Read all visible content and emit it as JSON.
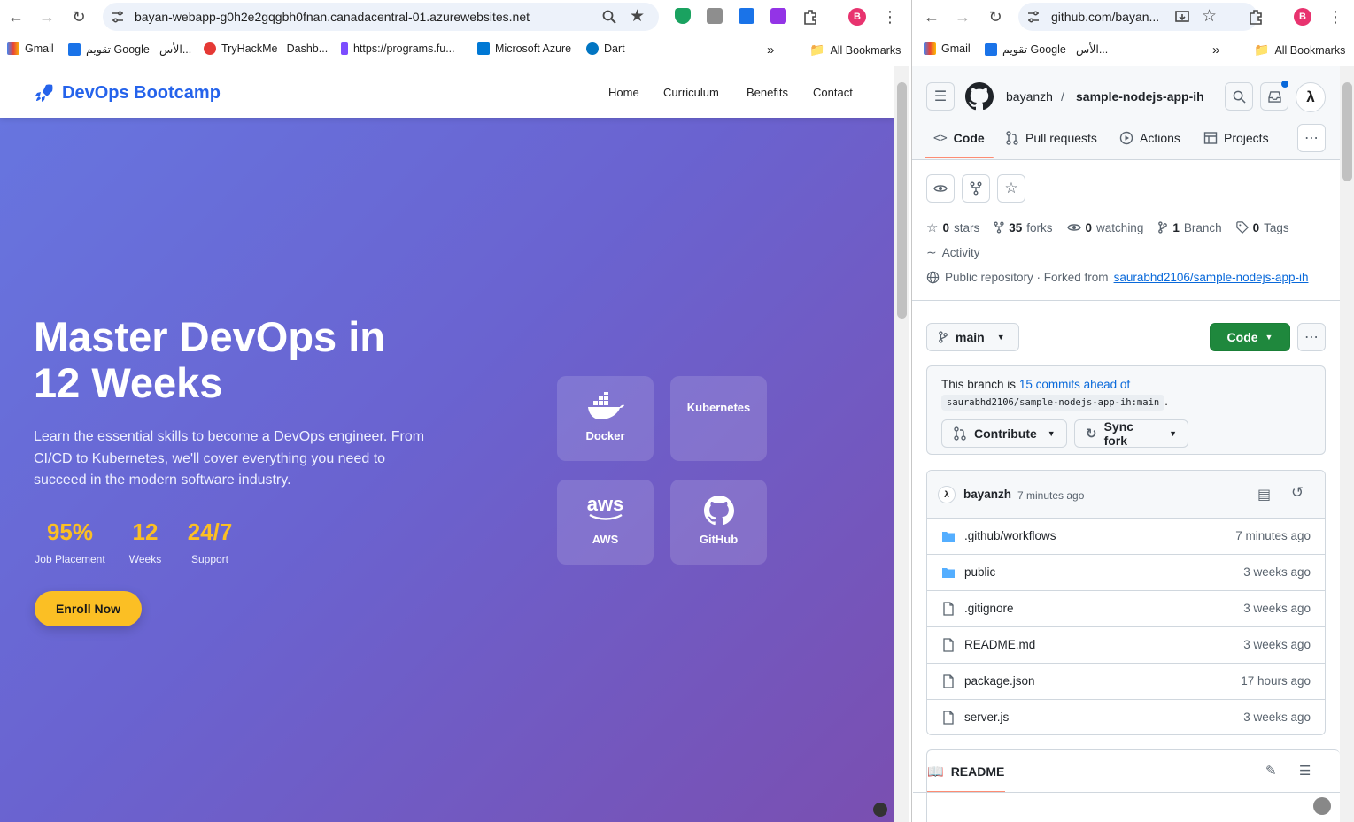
{
  "left_browser": {
    "url": "bayan-webapp-g0h2e2gqgbh0fnan.canadacentral-01.azurewebsites.net",
    "profile_initial": "B",
    "bookmarks": [
      "Gmail",
      "تقويم Google - الأس...",
      "TryHackMe | Dashb...",
      "https://programs.fu...",
      "Microsoft Azure",
      "Dart"
    ],
    "more_bookmarks": "»",
    "all_bookmarks": "All Bookmarks"
  },
  "devops_page": {
    "brand": "DevOps Bootcamp",
    "nav": [
      "Home",
      "Curriculum",
      "Benefits",
      "Contact"
    ],
    "hero_title": "Master DevOps in 12 Weeks",
    "hero_subtitle": "Learn the essential skills to become a DevOps engineer. From CI/CD to Kubernetes, we'll cover everything you need to succeed in the modern software industry.",
    "stats": [
      {
        "value": "95%",
        "label": "Job Placement"
      },
      {
        "value": "12",
        "label": "Weeks"
      },
      {
        "value": "24/7",
        "label": "Support"
      }
    ],
    "cta": "Enroll Now",
    "tech_cards": [
      "Docker",
      "Kubernetes",
      "AWS",
      "GitHub"
    ],
    "aws_logo_text": "aws",
    "colors": {
      "brand": "#2563eb",
      "accent": "#fbbf24",
      "hero_start": "#6775df",
      "hero_end": "#7a4fb1"
    }
  },
  "right_browser": {
    "url": "github.com/bayan...",
    "profile_initial": "B",
    "bookmarks": [
      "Gmail",
      "تقويم Google - الأس..."
    ],
    "more_bookmarks": "»",
    "all_bookmarks": "All Bookmarks"
  },
  "github": {
    "owner": "bayanzh",
    "separator": "/",
    "repo": "sample-nodejs-app-ih",
    "avatar_glyph": "λ",
    "tabs": [
      "Code",
      "Pull requests",
      "Actions",
      "Projects"
    ],
    "stats": {
      "stars": "0",
      "stars_label": "stars",
      "forks": "35",
      "forks_label": "forks",
      "watching": "0",
      "watching_label": "watching",
      "branches": "1",
      "branches_label": "Branch",
      "tags": "0",
      "tags_label": "Tags"
    },
    "activity": "Activity",
    "visibility": "Public repository · Forked from",
    "fork_source": "saurabhd2106/sample-nodejs-app-ih",
    "branch": "main",
    "code_button": "Code",
    "ahead_text": "This branch is",
    "ahead_link": "15 commits ahead of",
    "ahead_ref": "saurabhd2106/sample-nodejs-app-ih:main",
    "ahead_period": ".",
    "contribute": "Contribute",
    "sync_fork": "Sync fork",
    "commit_author": "bayanzh",
    "commit_time": "7 minutes ago",
    "files": [
      {
        "name": ".github/workflows",
        "type": "folder",
        "time": "7 minutes ago"
      },
      {
        "name": "public",
        "type": "folder",
        "time": "3 weeks ago"
      },
      {
        "name": ".gitignore",
        "type": "file",
        "time": "3 weeks ago"
      },
      {
        "name": "README.md",
        "type": "file",
        "time": "3 weeks ago"
      },
      {
        "name": "package.json",
        "type": "file",
        "time": "17 hours ago"
      },
      {
        "name": "server.js",
        "type": "file",
        "time": "3 weeks ago"
      }
    ],
    "readme_tab": "README",
    "colors": {
      "link": "#0969da",
      "green": "#1f883d",
      "tab_underline": "#fd8c73",
      "folder": "#54aeff"
    }
  }
}
